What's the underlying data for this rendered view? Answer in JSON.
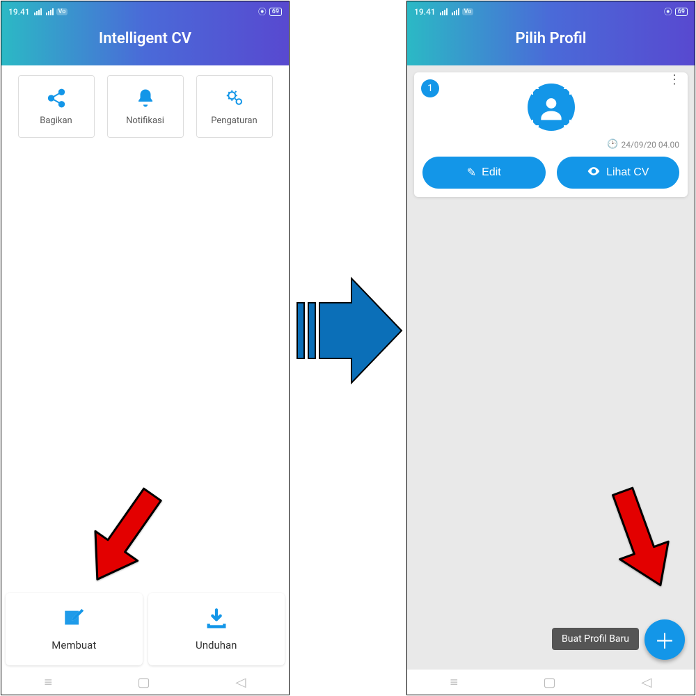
{
  "status": {
    "time": "19.41",
    "battery": "69"
  },
  "left": {
    "title": "Intelligent CV",
    "top_cards": [
      {
        "label": "Bagikan",
        "icon": "share"
      },
      {
        "label": "Notifikasi",
        "icon": "bell"
      },
      {
        "label": "Pengaturan",
        "icon": "gears"
      }
    ],
    "bottom_cards": [
      {
        "label": "Membuat",
        "icon": "compose"
      },
      {
        "label": "Unduhan",
        "icon": "download"
      }
    ]
  },
  "right": {
    "title": "Pilih Profil",
    "profile": {
      "number": "1",
      "timestamp": "24/09/20 04.00",
      "edit_label": "Edit",
      "view_label": "Lihat CV"
    },
    "fab_tooltip": "Buat Profil Baru"
  },
  "nav": {
    "recent": "≡",
    "home": "▢",
    "back": "◁"
  },
  "colors": {
    "accent": "#1396e8",
    "grad_start": "#2bb9c5",
    "grad_end": "#5849d0",
    "arrow_blue": "#0b6fb8",
    "arrow_red": "#e30000"
  }
}
